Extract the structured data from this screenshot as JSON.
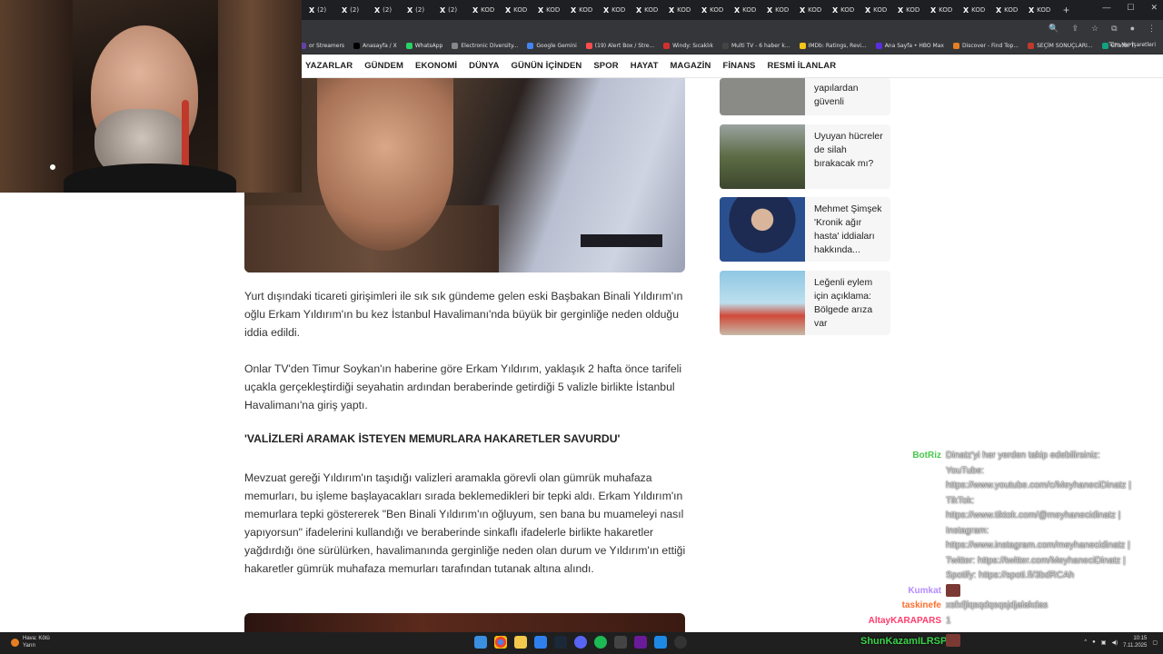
{
  "browser": {
    "tabs": [
      {
        "icon": "x-icon",
        "label": "(2)"
      },
      {
        "icon": "x-icon",
        "label": "(2)"
      },
      {
        "icon": "x-icon",
        "label": "(2)"
      },
      {
        "icon": "x-icon",
        "label": "(2)"
      },
      {
        "icon": "x-icon",
        "label": "(2)"
      },
      {
        "icon": "x-icon",
        "label": "KOD"
      },
      {
        "icon": "x-icon",
        "label": "KOD"
      },
      {
        "icon": "x-icon",
        "label": "KOD"
      },
      {
        "icon": "x-icon",
        "label": "KOD"
      },
      {
        "icon": "x-icon",
        "label": "KOD"
      },
      {
        "icon": "x-icon",
        "label": "KOD"
      },
      {
        "icon": "x-icon",
        "label": "KOD"
      },
      {
        "icon": "x-icon",
        "label": "KOD"
      },
      {
        "icon": "x-icon",
        "label": "KOD"
      },
      {
        "icon": "x-icon",
        "label": "KOD"
      },
      {
        "icon": "x-icon",
        "label": "KOD"
      },
      {
        "icon": "x-icon",
        "label": "KOD"
      },
      {
        "icon": "x-icon",
        "label": "KOD"
      },
      {
        "icon": "x-icon",
        "label": "KOD"
      },
      {
        "icon": "x-icon",
        "label": "KOD"
      },
      {
        "icon": "x-icon",
        "label": "KOD"
      },
      {
        "icon": "x-icon",
        "label": "KOD"
      },
      {
        "icon": "x-icon",
        "label": "KOD"
      }
    ],
    "bookmarks": [
      {
        "label": "or Streamers",
        "color": "#6441a5"
      },
      {
        "label": "Anasayfa / X",
        "color": "#000000"
      },
      {
        "label": "WhatsApp",
        "color": "#25d366"
      },
      {
        "label": "Electronic Diversity...",
        "color": "#888888"
      },
      {
        "label": "Google Gemini",
        "color": "#4285f4"
      },
      {
        "label": "(19) Alert Box / Stre...",
        "color": "#ff4d4d"
      },
      {
        "label": "Windy: Sıcaklık",
        "color": "#d32f2f"
      },
      {
        "label": "Multi TV - 6 haber k...",
        "color": "#444444"
      },
      {
        "label": "IMDb: Ratings, Revi...",
        "color": "#f5c518"
      },
      {
        "label": "Ana Sayfa • HBO Max",
        "color": "#5b2ee0"
      },
      {
        "label": "Discover - Find Top...",
        "color": "#e67e22"
      },
      {
        "label": "SEÇİM SONUÇLARI...",
        "color": "#c0392b"
      },
      {
        "label": "ChatGPT",
        "color": "#10a37f"
      }
    ],
    "bookmarks_right": "Tüm Yer İşaretleri"
  },
  "site_nav": [
    "YAZARLAR",
    "GÜNDEM",
    "EKONOMİ",
    "DÜNYA",
    "GÜNÜN İÇİNDEN",
    "SPOR",
    "HAYAT",
    "MAGAZİN",
    "FİNANS",
    "RESMİ İLANLAR"
  ],
  "article": {
    "p1": "Yurt dışındaki ticareti girişimleri ile sık sık gündeme gelen eski Başbakan Binali Yıldırım'ın oğlu Erkam Yıldırım'ın bu kez İstanbul Havalimanı'nda büyük bir gerginliğe neden olduğu iddia edildi.",
    "p2": "Onlar TV'den Timur Soykan'ın haberine göre Erkam Yıldırım, yaklaşık 2 hafta önce tarifeli uçakla gerçekleştirdiği seyahatin ardından beraberinde getirdiği 5 valizle birlikte İstanbul Havalimanı'na giriş yaptı.",
    "heading": "'VALİZLERİ ARAMAK İSTEYEN MEMURLARA HAKARETLER SAVURDU'",
    "p3": "Mevzuat gereği Yıldırım'ın taşıdığı valizleri aramakla görevli olan gümrük muhafaza memurları, bu işleme başlayacakları sırada beklemedikleri bir tepki aldı. Erkam Yıldırım'ın memurlara tepki göstererek \"Ben Binali Yıldırım'ın oğluyum, sen bana bu muameleyi nasıl yapıyorsun\" ifadelerini kullandığı ve beraberinde sinkaflı ifadelerle birlikte hakaretler yağdırdığı öne sürülürken, havalimanında gerginliğe neden olan durum ve Yıldırım'ın ettiği hakaretler gümrük muhafaza memurları tarafından tutanak altına alındı."
  },
  "sidebar": [
    {
      "title": "yapılardan güvenli",
      "thumb": "#8a8a86"
    },
    {
      "title": "Uyuyan hücreler de silah bırakacak mı?",
      "thumb": "#6f7a5a"
    },
    {
      "title": "Mehmet Şimşek 'Kronik ağır hasta' iddiaları hakkında...",
      "thumb": "#2a4f8f"
    },
    {
      "title": "Leğenli eylem için açıklama: Bölgede arıza var",
      "thumb": "#6fb6d9"
    }
  ],
  "chat": [
    {
      "nick": "BotRiz",
      "color": "#48c74b",
      "lines": [
        "Dinatz'yi her yerden takip edebilirsiniz:",
        "YouTube:",
        "https://www.youtube.com/c/MeyhaneciDinatz |",
        "TikTok:",
        "https://www.tiktok.com/@meyhanecidinatz |",
        "Instagram:",
        "https://www.instagram.com/meyhanecidinatz |",
        "Twitter: https://twitter.com/MeyhaneciDinatz |",
        "Spotify: https://spoti.fi/3bdRCAh"
      ]
    },
    {
      "nick": "Kumkat",
      "color": "#b58cff",
      "lines": [
        ""
      ]
    },
    {
      "nick": "taskinefe",
      "color": "#ff6e2e",
      "lines": [
        "xsfxfjlqsqdqsqsjdjalakdas"
      ]
    },
    {
      "nick": "AltayKARAPARS",
      "color": "#ff3b6b",
      "lines": [
        "1"
      ]
    },
    {
      "nick": "ShunKazamILRSP",
      "color": "#3ad34a",
      "lines": [
        ""
      ]
    }
  ],
  "taskbar": {
    "weather_line1": "Hava: Kötü",
    "weather_line2": "Yarın",
    "time": "10:15",
    "date": "7.11.2025"
  }
}
